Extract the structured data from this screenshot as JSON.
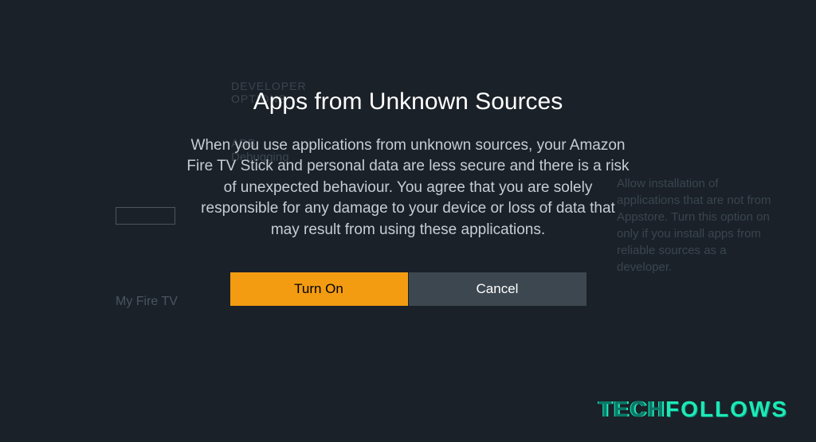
{
  "background": {
    "header": "DEVELOPER OPTIONS",
    "item1": "ADB Debugging",
    "nav_label": "My Fire TV",
    "description": "Allow installation of applications that are not from Appstore. Turn this option on only if you install apps from reliable sources as a developer."
  },
  "dialog": {
    "title": "Apps from Unknown Sources",
    "body": "When you use applications from unknown sources, your Amazon Fire TV Stick and personal data are less secure and there is a risk of unexpected behaviour. You agree that you are solely responsible for any damage to your device or loss of data that may result from using these applications.",
    "button_primary": "Turn On",
    "button_secondary": "Cancel"
  },
  "watermark": {
    "part1": "TECH",
    "part2": "FOLLOWS"
  }
}
